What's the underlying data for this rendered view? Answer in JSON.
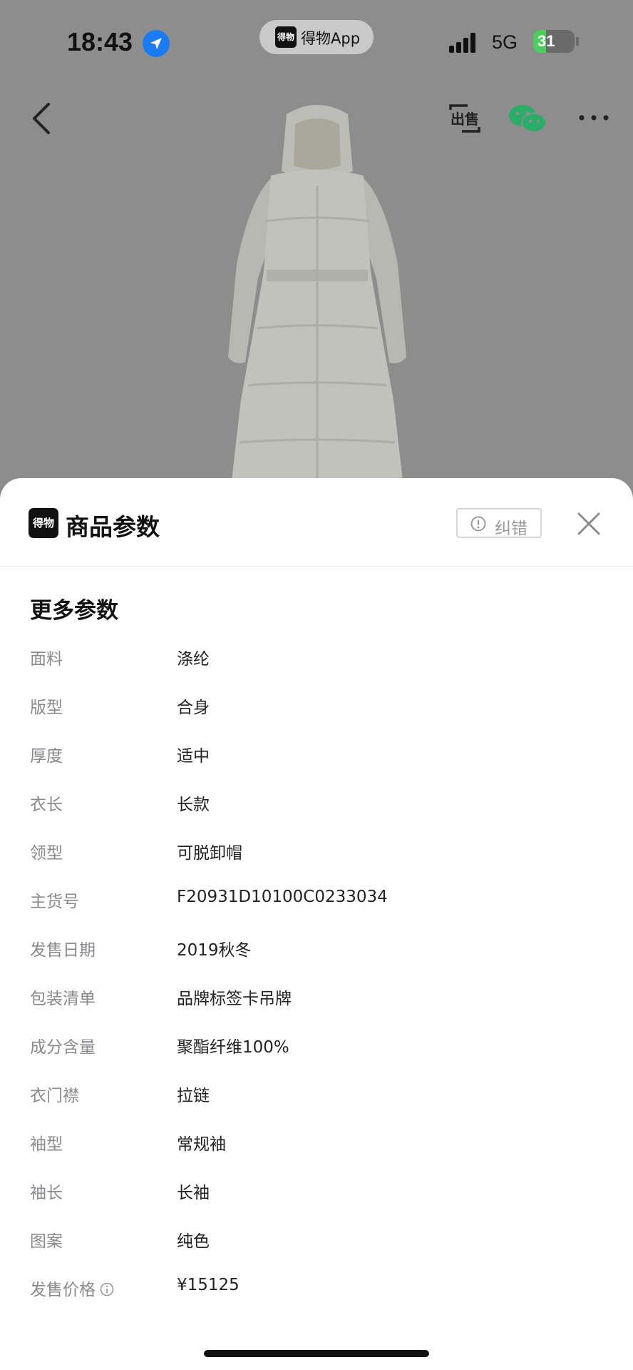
{
  "status_bar": {
    "time": "18:43",
    "app_pill": "得物App",
    "app_pill_logo": "得物",
    "network": "5G",
    "battery": "31",
    "battery_level": 0.31
  },
  "nav": {
    "back_icon": "chevron-left-icon",
    "sell_icon": "sell-exchange-icon",
    "wechat_icon": "wechat-icon",
    "more_icon": "more-horizontal-icon"
  },
  "sheet": {
    "brand_logo": "得物",
    "title": "商品参数",
    "report_label": "纠错",
    "section_title": "更多参数",
    "params": [
      {
        "key": "面料",
        "value": "涤纶"
      },
      {
        "key": "版型",
        "value": "合身"
      },
      {
        "key": "厚度",
        "value": "适中"
      },
      {
        "key": "衣长",
        "value": "长款"
      },
      {
        "key": "领型",
        "value": "可脱卸帽"
      },
      {
        "key": "主货号",
        "value": "F20931D10100C0233034"
      },
      {
        "key": "发售日期",
        "value": "2019秋冬"
      },
      {
        "key": "包装清单",
        "value": "品牌标签卡吊牌"
      },
      {
        "key": "成分含量",
        "value": "聚酯纤维100%"
      },
      {
        "key": "衣门襟",
        "value": "拉链"
      },
      {
        "key": "袖型",
        "value": "常规袖"
      },
      {
        "key": "袖长",
        "value": "长袖"
      },
      {
        "key": "图案",
        "value": "纯色"
      },
      {
        "key": "发售价格",
        "value": "¥15125"
      }
    ]
  },
  "colors": {
    "overlay": "#8d8d8d",
    "location_blue": "#1a7cf5",
    "wechat_green": "#2aae67",
    "battery_green": "#4ccd5e",
    "key_gray": "#8a8a8e"
  }
}
